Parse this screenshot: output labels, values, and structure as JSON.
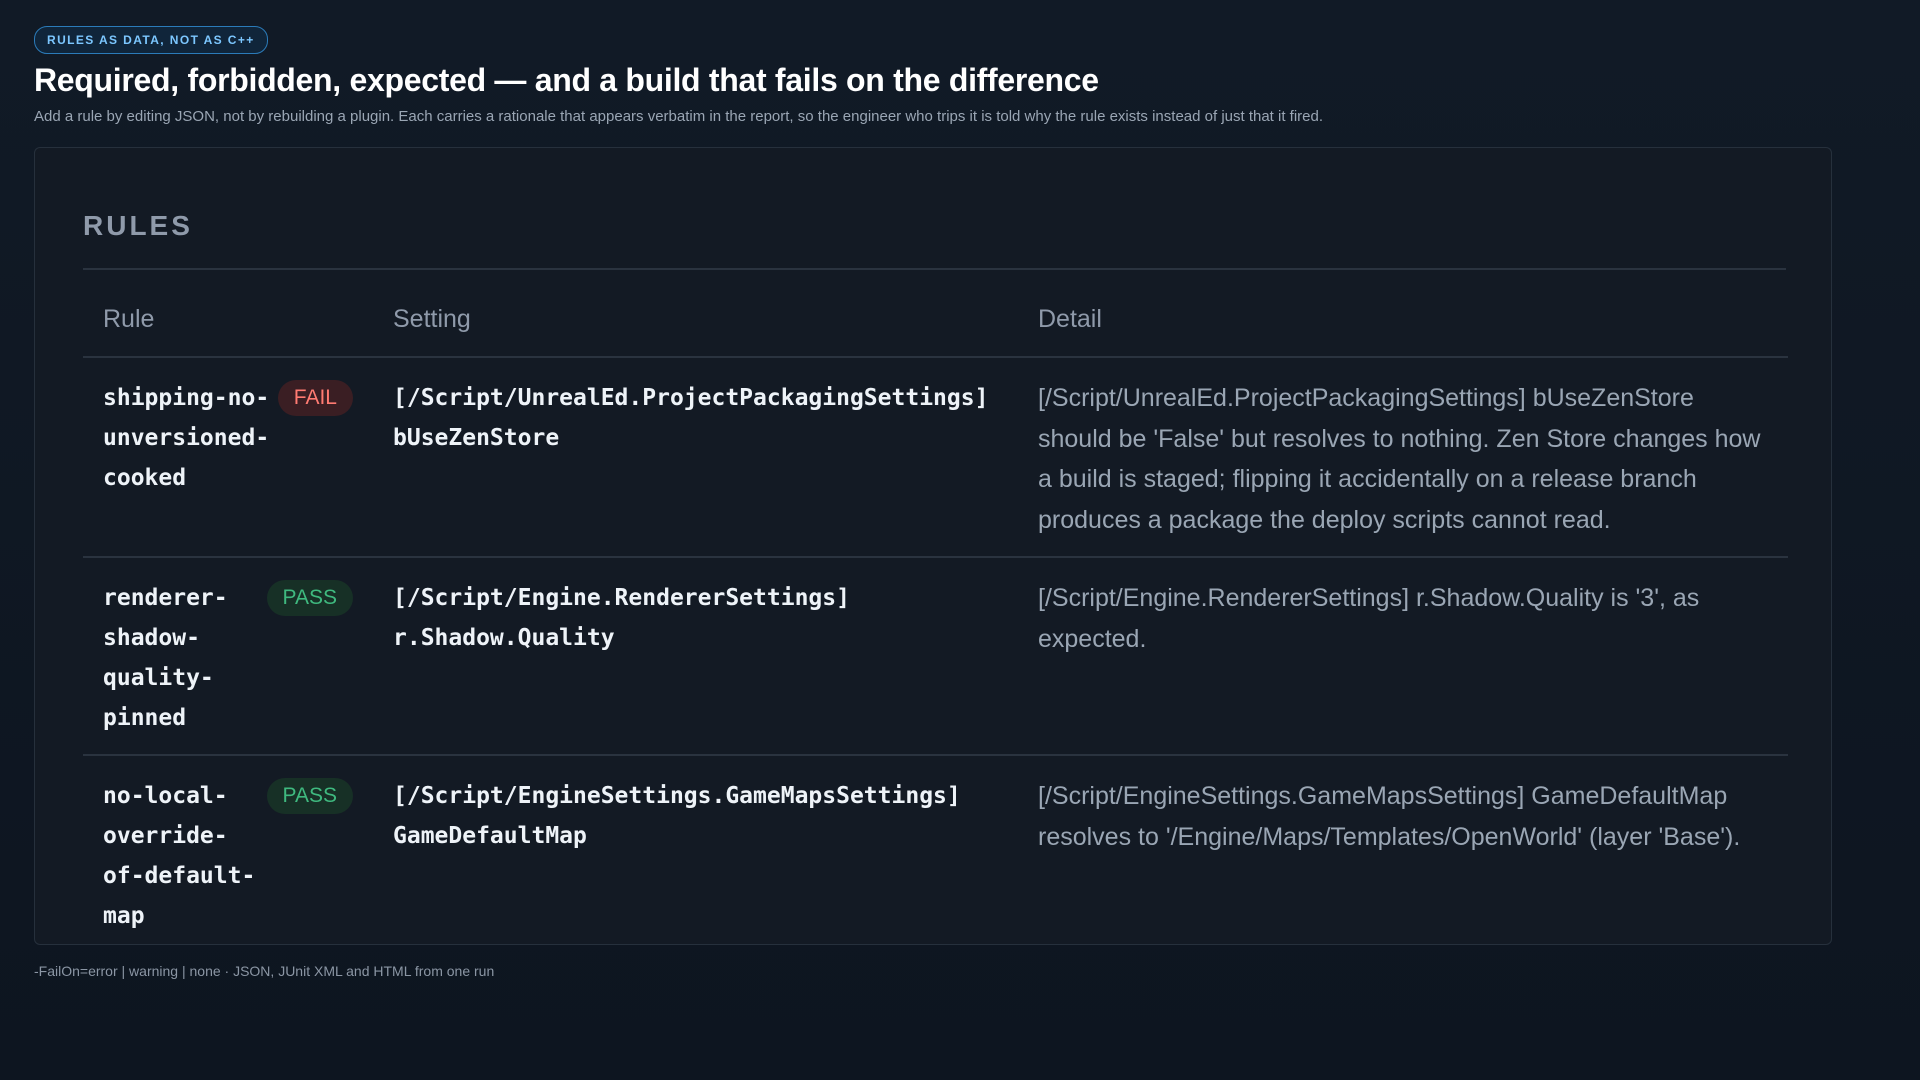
{
  "header": {
    "eyebrow": "RULES AS DATA, NOT AS C++",
    "title": "Required, forbidden, expected — and a build that fails on the difference",
    "subtitle": "Add a rule by editing JSON, not by rebuilding a plugin. Each carries a rationale that appears verbatim in the report, so the engineer who trips it is told why the rule exists instead of just that it fired."
  },
  "panel": {
    "heading": "RULES",
    "columns": [
      "Rule",
      "Setting",
      "Detail"
    ],
    "rows": [
      {
        "rule": "shipping-no-unversioned-cooked",
        "status": "FAIL",
        "setting": "[/Script/UnrealEd.ProjectPackagingSettings]\nbUseZenStore",
        "detail": "[/Script/UnrealEd.ProjectPackagingSettings] bUseZenStore should be 'False' but resolves to nothing. Zen Store changes how a build is staged; flipping it accidentally on a release branch produces a package the deploy scripts cannot read."
      },
      {
        "rule": "renderer-shadow-quality-pinned",
        "status": "PASS",
        "setting": "[/Script/Engine.RendererSettings]\nr.Shadow.Quality",
        "detail": "[/Script/Engine.RendererSettings] r.Shadow.Quality is '3', as expected."
      },
      {
        "rule": "no-local-override-of-default-map",
        "status": "PASS",
        "setting": "[/Script/EngineSettings.GameMapsSettings]\nGameDefaultMap",
        "detail": "[/Script/EngineSettings.GameMapsSettings] GameDefaultMap resolves to '/Engine/Maps/Templates/OpenWorld' (layer 'Base')."
      }
    ]
  },
  "footer": "-FailOn=error | warning | none · JSON, JUnit XML and HTML from one run",
  "colors": {
    "fail": "#ff7b72",
    "pass": "#3fb97f",
    "accent": "#7cc7ff"
  }
}
